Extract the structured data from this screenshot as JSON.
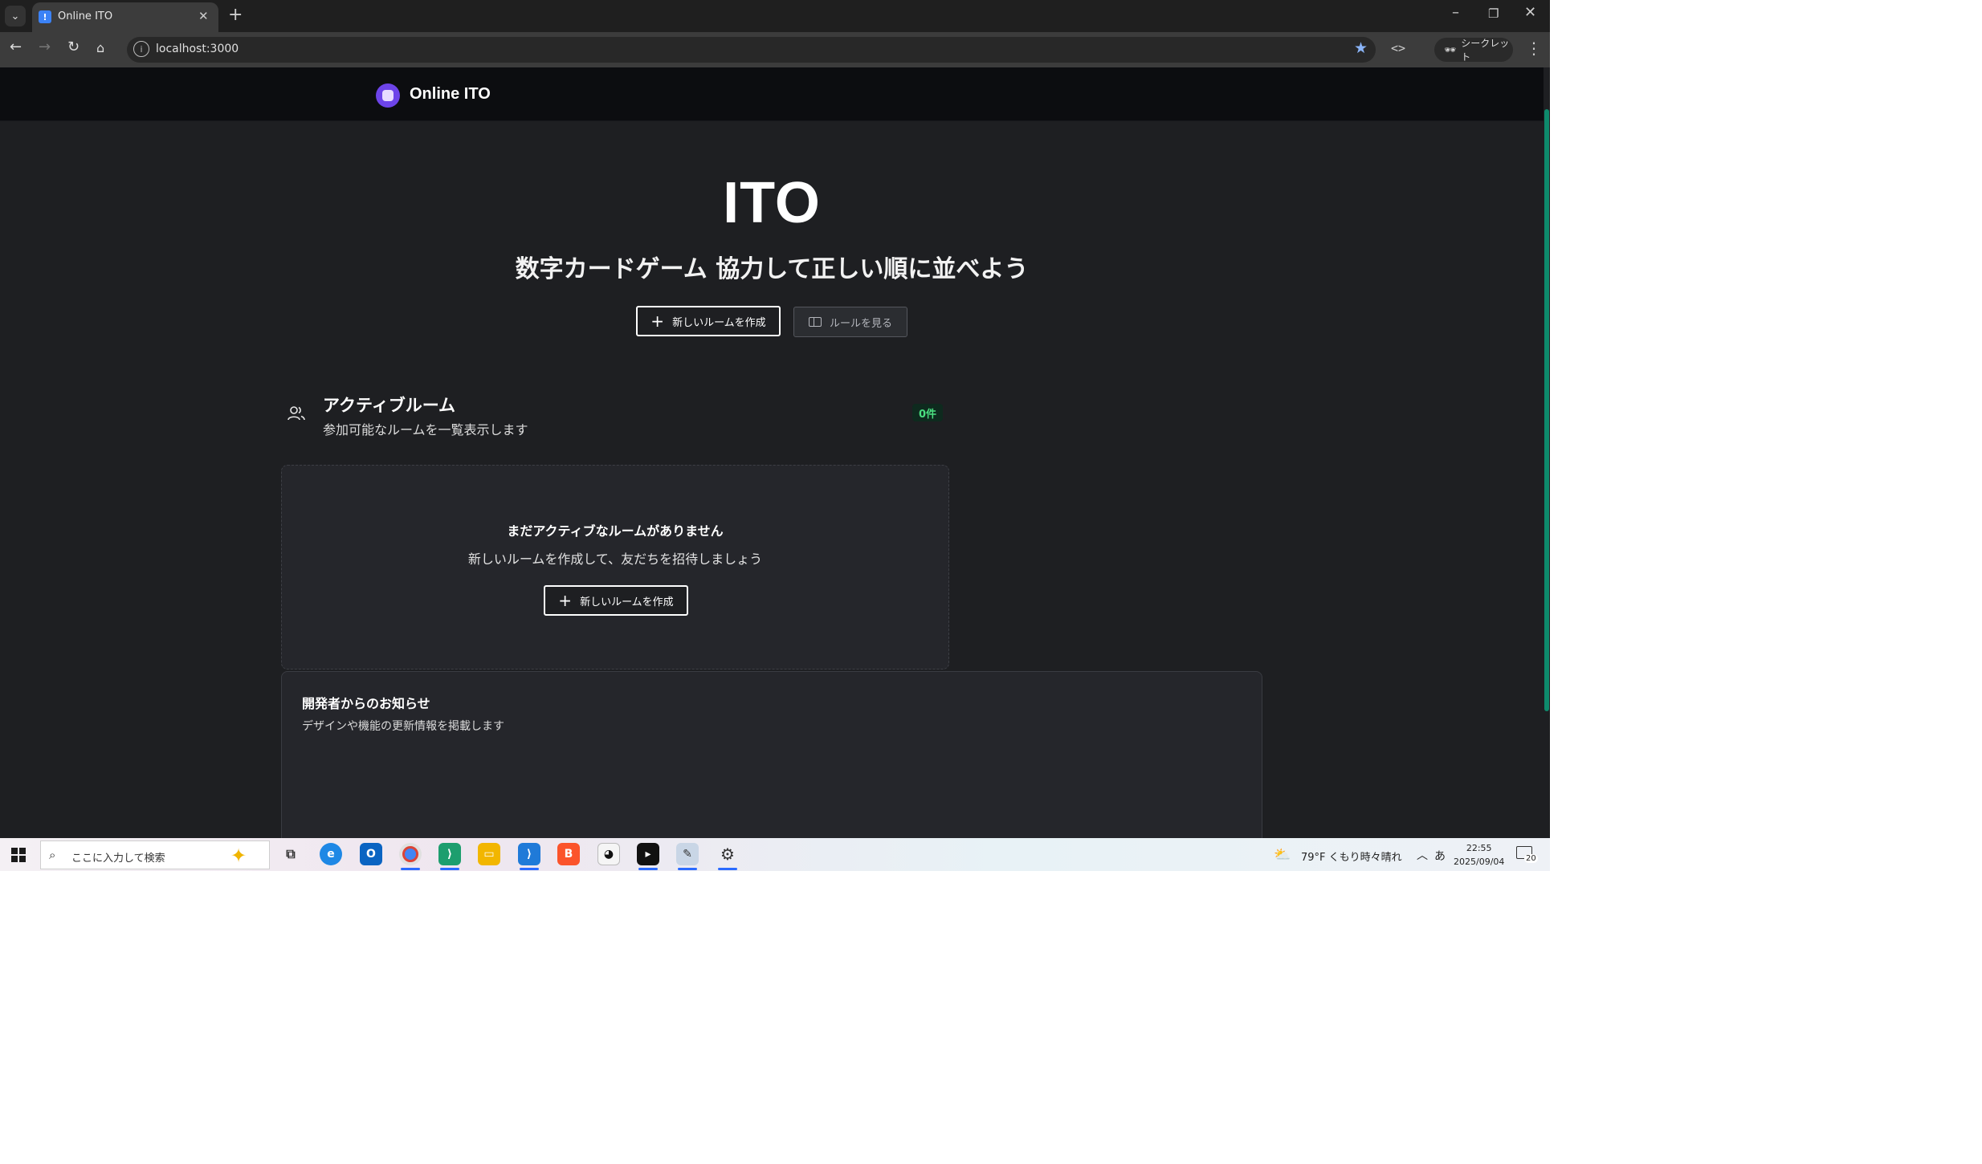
{
  "browser": {
    "tab_title": "Online ITO",
    "tab_favicon": "!",
    "url": "localhost:3000",
    "incognito_label": "シークレット"
  },
  "site": {
    "logo_text": "Online ITO"
  },
  "hero": {
    "title": "ITO",
    "subtitle": "数字カードゲーム 協力して正しい順に並べよう",
    "create_room_label": "新しいルームを作成",
    "rules_label": "ルールを見る"
  },
  "active_rooms": {
    "title": "アクティブルーム",
    "description": "参加可能なルームを一覧表示します",
    "count_badge": "0件",
    "empty_title": "まだアクティブなルームがありません",
    "empty_description": "新しいルームを作成して、友だちを招待しましょう",
    "empty_button_label": "新しいルームを作成"
  },
  "notice": {
    "title": "開発者からのお知らせ",
    "description": "デザインや機能の更新情報を掲載します"
  },
  "taskbar": {
    "search_placeholder": "ここに入力して検索",
    "weather": "79°F くもり時々晴れ",
    "time": "22:55",
    "date": "2025/09/04",
    "notification_count": "20",
    "ime": "あ"
  },
  "colors": {
    "page_bg": "#1e1f22",
    "header_bg": "#0c0d10",
    "logo_accent": "#6d44e9",
    "badge_text": "#4ade80",
    "scroll_thumb": "#0e8a6c"
  }
}
